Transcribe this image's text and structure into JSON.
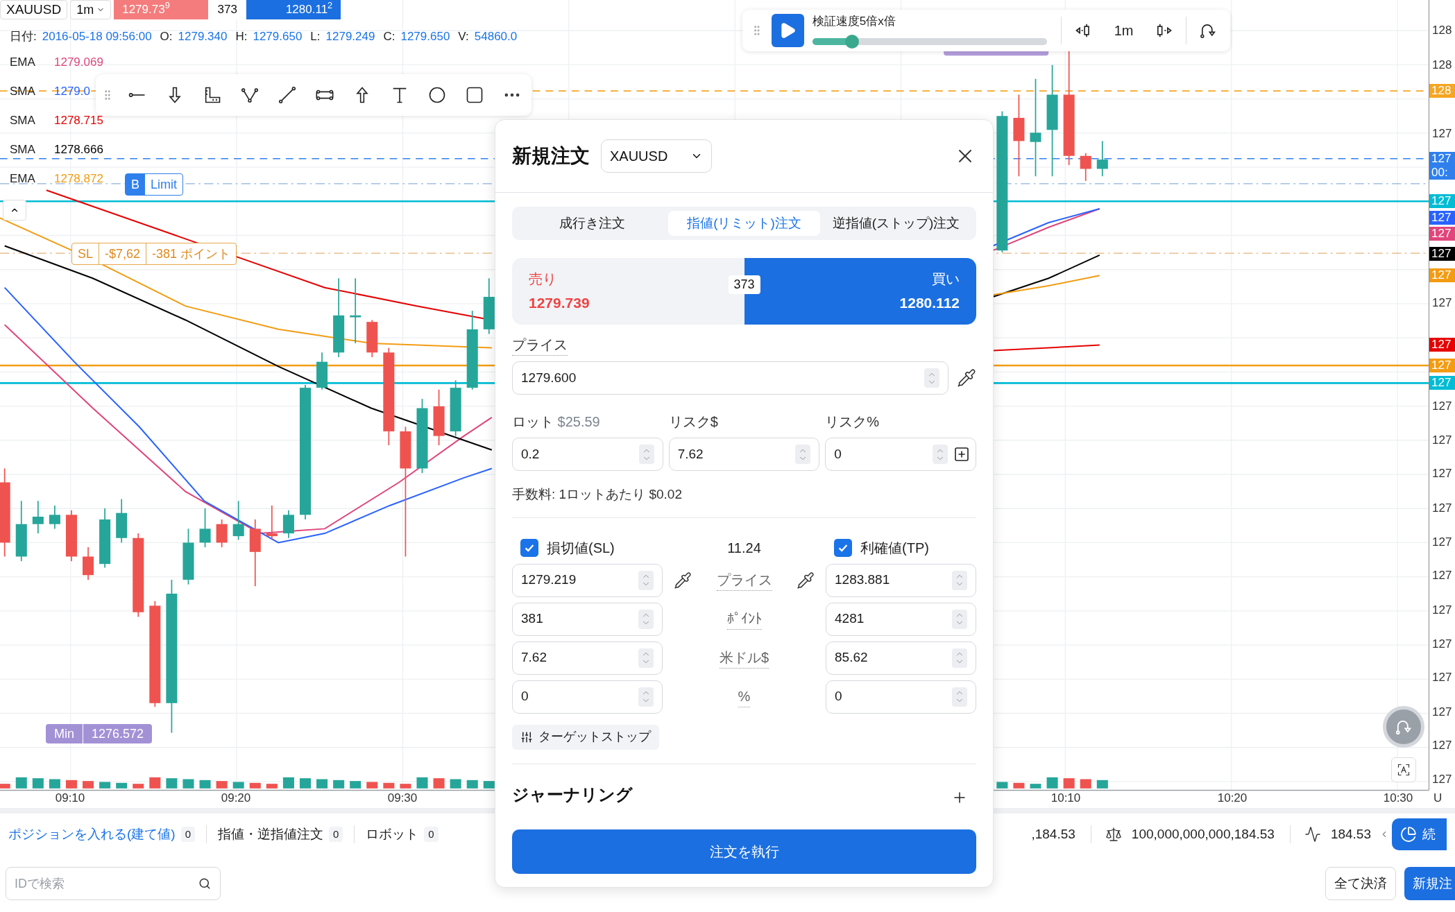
{
  "header": {
    "symbol": "XAUUSD",
    "timeframe": "1m",
    "sell_price": "1279.73$^{9}$",
    "spread": "373",
    "buy_price": "1280.11$^{2}$"
  },
  "ohlc": [
    {
      "label": "日付:",
      "value": "2016-05-18 09:56:00"
    },
    {
      "label": "O:",
      "value": "1279.340"
    },
    {
      "label": "H:",
      "value": "1279.650"
    },
    {
      "label": "L:",
      "value": "1279.249"
    },
    {
      "label": "C:",
      "value": "1279.650"
    },
    {
      "label": "V:",
      "value": "54860.0"
    }
  ],
  "indicators": [
    {
      "name": "EMA",
      "value": "1279.069",
      "color": "#e0457b"
    },
    {
      "name": "SMA",
      "value": "1279.0",
      "color": "#2962ff"
    },
    {
      "name": "SMA",
      "value": "1278.715",
      "color": "#e60000"
    },
    {
      "name": "SMA",
      "value": "1278.666",
      "color": "#000000"
    },
    {
      "name": "EMA",
      "value": "1278.872",
      "color": "#f39c12"
    }
  ],
  "chart_labels": {
    "order_side": "B",
    "order_type": "Limit",
    "sl_name": "SL",
    "sl_amount": "-$7,62",
    "sl_points": "-381 ポイント",
    "min_name": "Min",
    "min_value": "1276.572"
  },
  "replay": {
    "speed_label": "検証速度5倍x倍",
    "level": 0.17,
    "timeframe": "1m"
  },
  "time_axis": [
    "09:10",
    "09:20",
    "09:30",
    "10:10",
    "10:20",
    "10:30"
  ],
  "timezone": "U",
  "price_axis": {
    "labels": [
      "128",
      "128",
      "127",
      "127",
      "127",
      "127",
      "127",
      "127",
      "127",
      "127",
      "127",
      "127",
      "127",
      "127",
      "127",
      "127"
    ],
    "tags": [
      {
        "text": "128",
        "color": "#f5a623"
      },
      {
        "text": "127",
        "subtext": "00:",
        "color": "#2f80ed"
      },
      {
        "text": "127",
        "color": "#00bcd4"
      },
      {
        "text": "127",
        "color": "#2962ff"
      },
      {
        "text": "127",
        "color": "#e0457b"
      },
      {
        "text": "127",
        "color": "#000000"
      },
      {
        "text": "127",
        "color": "#f39c12"
      },
      {
        "text": "127",
        "color": "#e60000"
      },
      {
        "text": "127",
        "color": "#f39c12"
      },
      {
        "text": "127",
        "color": "#00bcd4"
      }
    ]
  },
  "dialog": {
    "title": "新規注文",
    "symbol": "XAUUSD",
    "tabs": [
      {
        "label": "成行き注文",
        "selected": false
      },
      {
        "label": "指値(リミット)注文",
        "selected": true
      },
      {
        "label": "逆指値(ストップ)注文",
        "selected": false
      }
    ],
    "sides": [
      {
        "kind": "sell",
        "label": "売り",
        "price": "1279.739",
        "selected": false
      },
      {
        "kind": "buy",
        "label": "買い",
        "price": "1280.112",
        "selected": true
      }
    ],
    "spread": "373",
    "price": {
      "label": "プライス",
      "value": "1279.600"
    },
    "lot": {
      "label": "ロット",
      "note": "$25.59",
      "value": "0.2"
    },
    "risk_usd": {
      "label": "リスク$",
      "value": "7.62"
    },
    "risk_pct": {
      "label": "リスク%",
      "value": "0"
    },
    "fee": "手数料: 1ロットあたり $0.02",
    "stop_loss": {
      "label": "損切値(SL)",
      "checked": true
    },
    "ratio": "11.24",
    "take_profit": {
      "label": "利確値(TP)",
      "checked": true
    },
    "rows": [
      {
        "label": "プライス",
        "sl": "1279.219",
        "tp": "1283.881"
      },
      {
        "label": "ﾎﾟｲﾝﾄ",
        "sl": "381",
        "tp": "4281"
      },
      {
        "label": "米ドル$",
        "sl": "7.62",
        "tp": "85.62"
      },
      {
        "label": "%",
        "sl": "0",
        "tp": "0"
      }
    ],
    "target_stop": "ターゲットストップ",
    "journaling": "ジャーナリング",
    "submit": "注文を執行"
  },
  "bottom": {
    "tabs": [
      {
        "label": "ポジションを入れる(建て値)",
        "count": "0",
        "selected": true
      },
      {
        "label": "指値・逆指値注文",
        "count": "0",
        "selected": false
      },
      {
        "label": "ロボット",
        "count": "0",
        "selected": false
      }
    ],
    "balance": ",184.53",
    "equity": "100,000,000,000,184.53",
    "profit": "184.53",
    "stats_button": "続",
    "search_placeholder": "IDで検索",
    "close_all": "全て決済",
    "new_order": "新規注"
  }
}
